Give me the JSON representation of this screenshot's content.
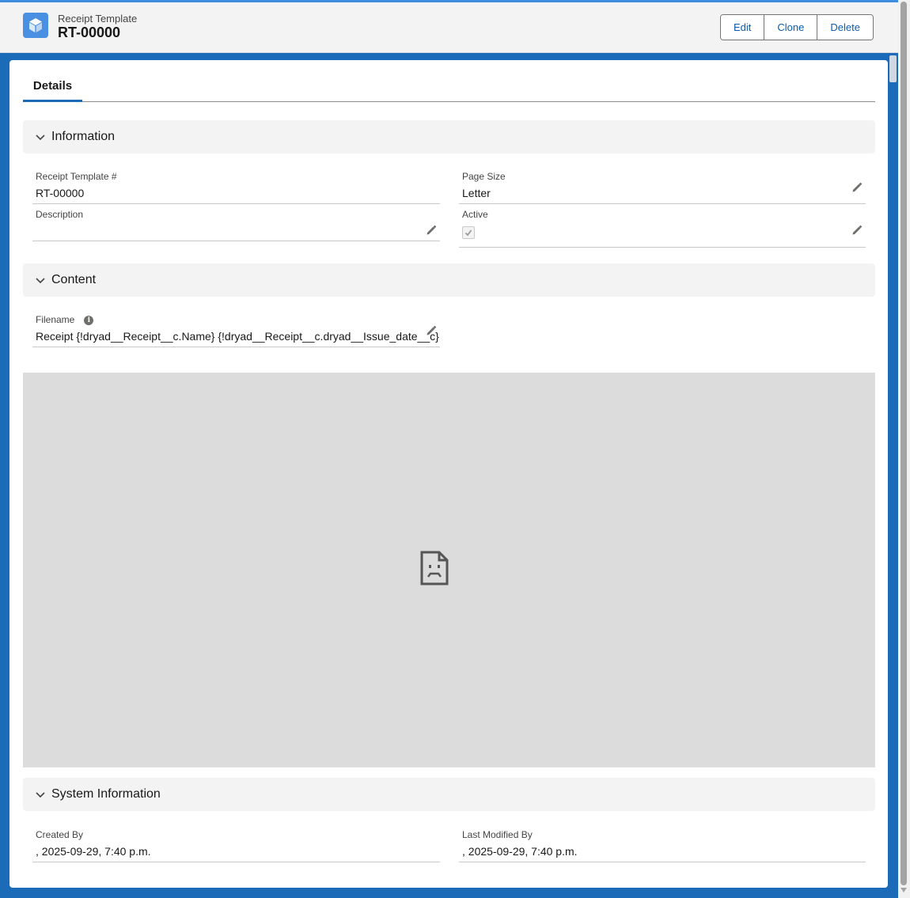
{
  "header": {
    "object_type": "Receipt Template",
    "record_name": "RT-00000",
    "icon": "cube-icon",
    "actions": [
      "Edit",
      "Clone",
      "Delete"
    ]
  },
  "tabs": [
    {
      "label": "Details",
      "active": true
    }
  ],
  "sections": {
    "information": {
      "title": "Information",
      "fields": {
        "receipt_template_number": {
          "label": "Receipt Template #",
          "value": "RT-00000"
        },
        "page_size": {
          "label": "Page Size",
          "value": "Letter"
        },
        "description": {
          "label": "Description",
          "value": ""
        },
        "active": {
          "label": "Active",
          "checked": true
        }
      }
    },
    "content": {
      "title": "Content",
      "fields": {
        "filename": {
          "label": "Filename",
          "value": "Receipt {!dryad__Receipt__c.Name} {!dryad__Receipt__c.dryad__Issue_date__c}"
        }
      }
    },
    "system": {
      "title": "System Information",
      "fields": {
        "created_by": {
          "label": "Created By",
          "value": ", 2025-09-29, 7:40 p.m."
        },
        "last_modified_by": {
          "label": "Last Modified By",
          "value": ", 2025-09-29, 7:40 p.m."
        }
      }
    }
  },
  "colors": {
    "brand": "#1b6bb8",
    "link": "#0b5cab",
    "section_bg": "#f3f3f3",
    "preview_bg": "#dcdcdc"
  }
}
